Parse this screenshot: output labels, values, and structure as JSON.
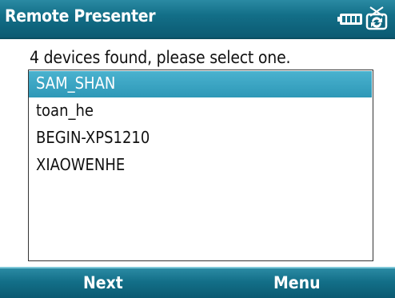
{
  "title_bar": {
    "title": "Remote Presenter",
    "icons": [
      "battery-icon",
      "sync-icon"
    ]
  },
  "prompt": "4 devices found, please select one.",
  "device_list": {
    "selected_index": 0,
    "items": [
      {
        "label": "SAM_SHAN"
      },
      {
        "label": "toan_he"
      },
      {
        "label": "BEGIN-XPS1210"
      },
      {
        "label": "XIAOWENHE"
      }
    ]
  },
  "softkeys": {
    "left": "Next",
    "right": "Menu"
  },
  "colors": {
    "bar": "#136f88",
    "selection": "#3aa5c4"
  }
}
